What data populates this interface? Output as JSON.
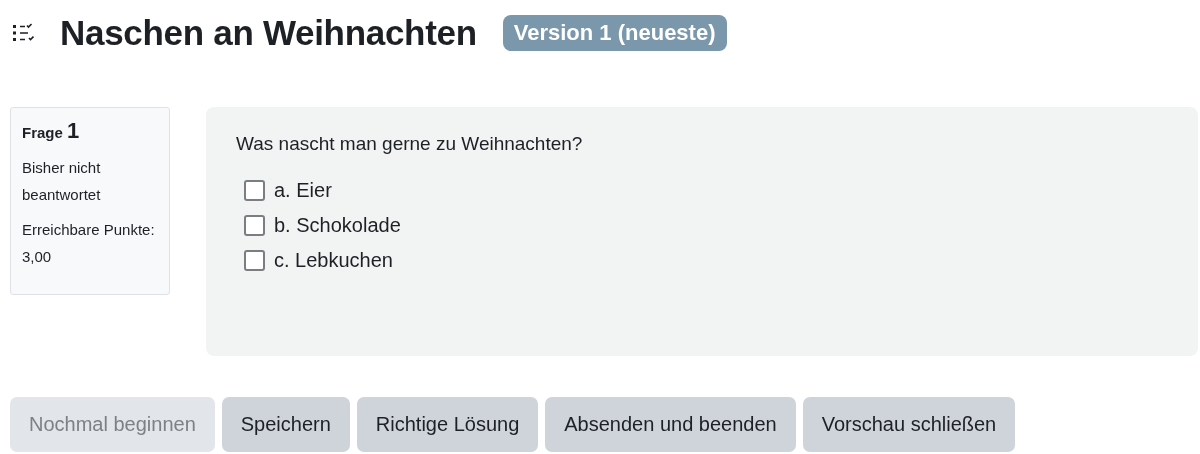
{
  "title": "Naschen an Weihnachten",
  "version_badge": "Version 1 (neueste)",
  "question_info": {
    "label": "Frage",
    "number": "1",
    "status": "Bisher nicht beantwortet",
    "points": "Erreichbare Punkte: 3,00"
  },
  "question": {
    "text": "Was nascht man gerne zu Weihnachten?",
    "options": [
      {
        "label": "a. Eier",
        "checked": false
      },
      {
        "label": "b. Schokolade",
        "checked": false
      },
      {
        "label": "c. Lebkuchen",
        "checked": false
      }
    ]
  },
  "buttons": [
    {
      "label": "Nochmal beginnen",
      "disabled": true
    },
    {
      "label": "Speichern",
      "disabled": false
    },
    {
      "label": "Richtige Lösung",
      "disabled": false
    },
    {
      "label": "Absenden und beenden",
      "disabled": false
    },
    {
      "label": "Vorschau schließen",
      "disabled": false
    }
  ]
}
